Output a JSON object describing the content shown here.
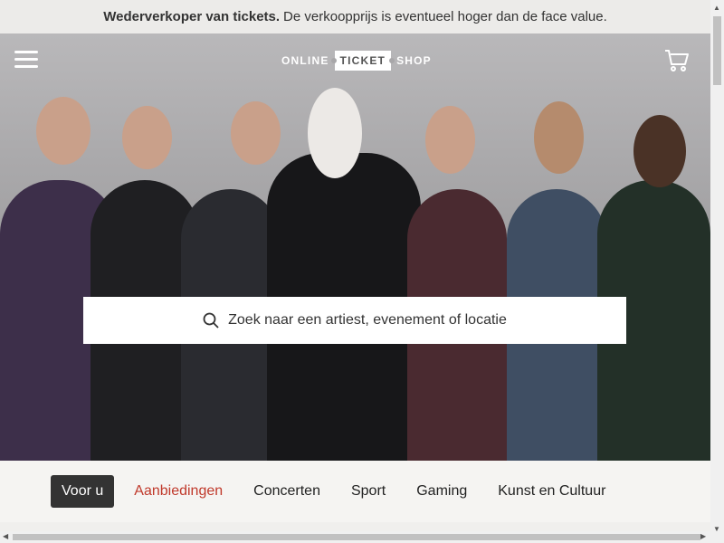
{
  "banner": {
    "bold": "Wederverkoper van tickets.",
    "text": "De verkoopprijs is eventueel hoger dan de face value."
  },
  "header": {
    "logo_left": "ONLINE",
    "logo_box": "TICKET",
    "logo_right": "SHOP",
    "menu_icon": "hamburger-menu-icon",
    "cart_icon": "shopping-cart-icon"
  },
  "hero": {
    "search_placeholder": "Zoek naar een artiest, evenement of locatie",
    "search_icon": "search-icon"
  },
  "nav": {
    "tabs": [
      {
        "label": "Voor u"
      },
      {
        "label": "Aanbiedingen"
      },
      {
        "label": "Concerten"
      },
      {
        "label": "Sport"
      },
      {
        "label": "Gaming"
      },
      {
        "label": "Kunst en Cultuur"
      }
    ]
  },
  "colors": {
    "accent": "#c0392b",
    "active_tab_bg": "#333333",
    "banner_bg": "#ecebe9"
  }
}
